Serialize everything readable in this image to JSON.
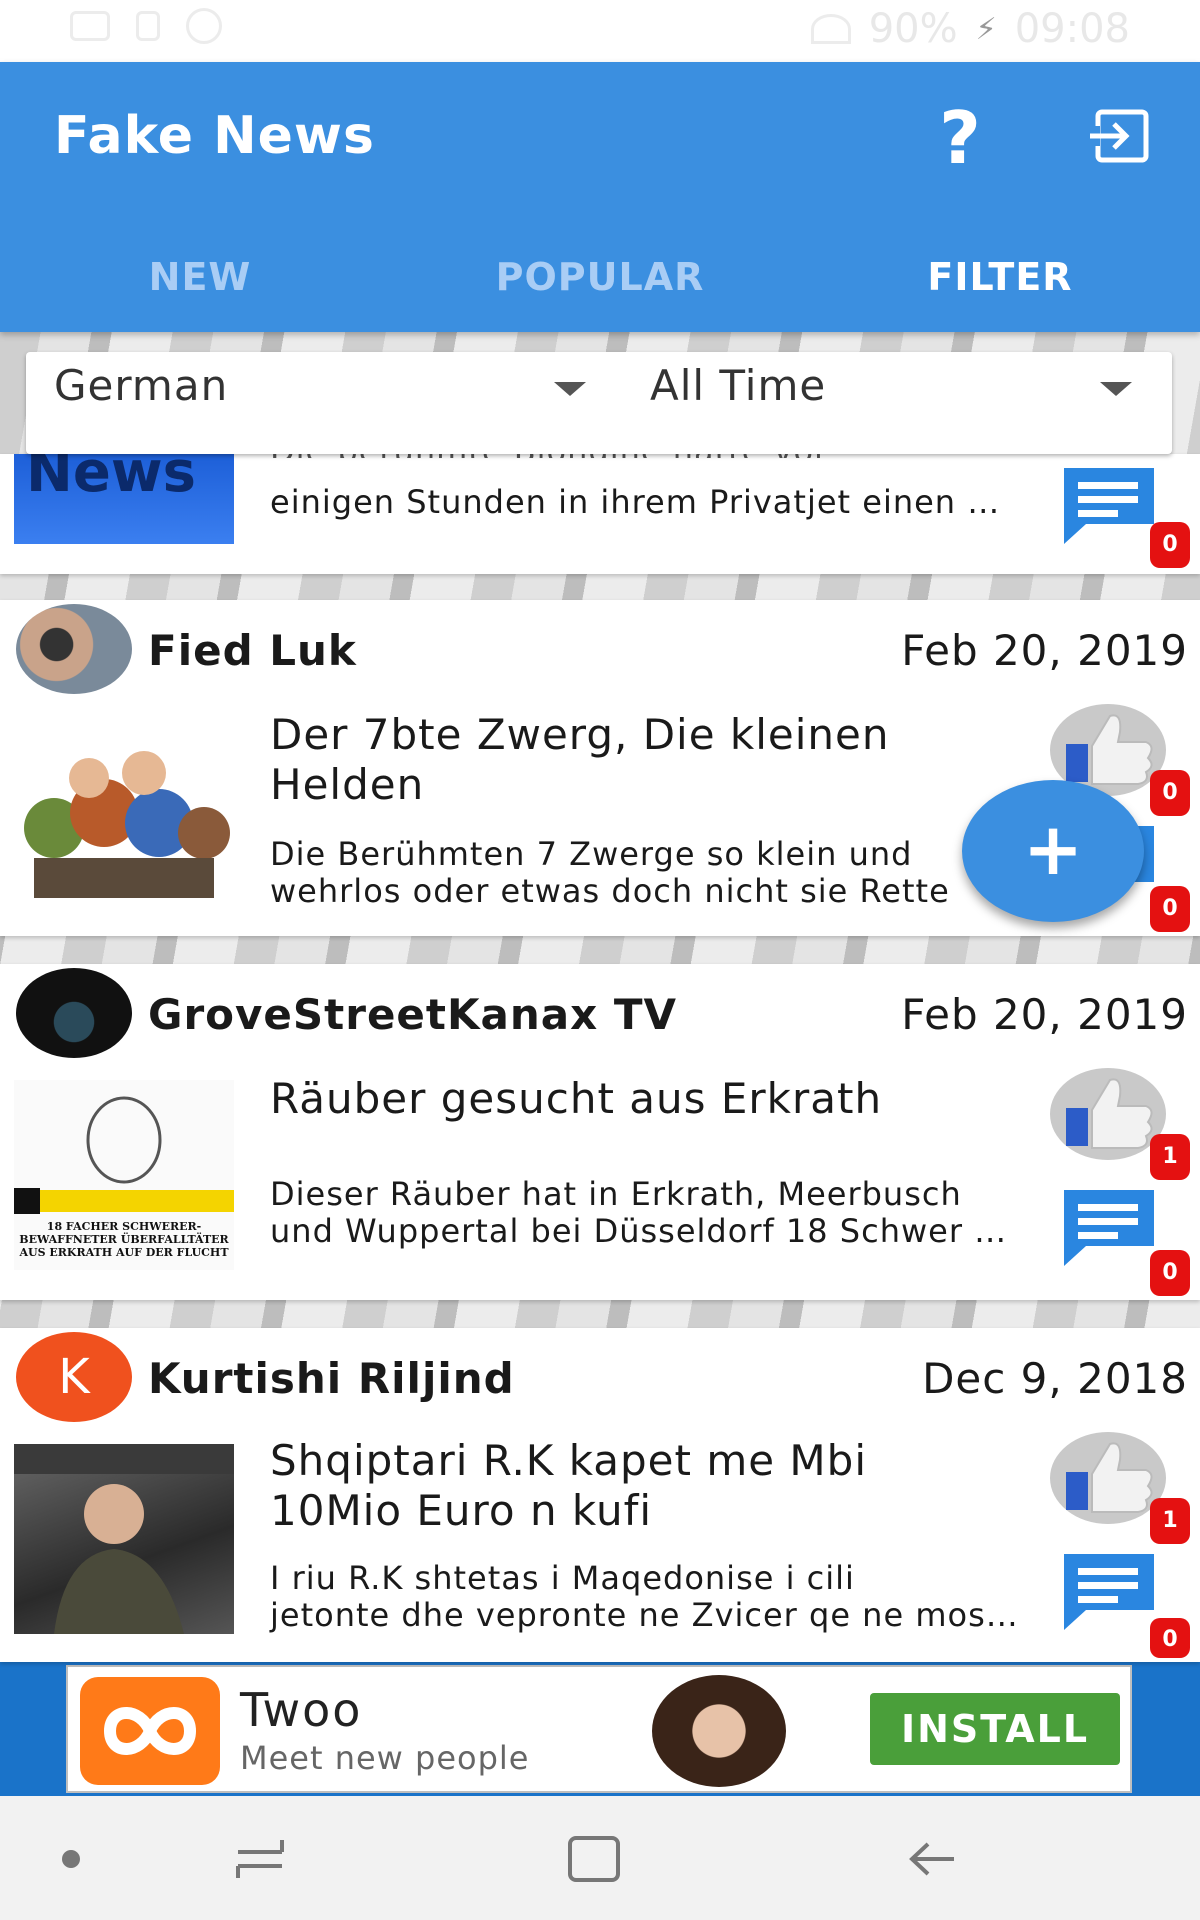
{
  "status_bar": {
    "battery": "90%",
    "time": "09:08"
  },
  "app_bar": {
    "title": "Fake News",
    "help_label": "?",
    "tabs": [
      {
        "label": "NEW"
      },
      {
        "label": "POPULAR"
      },
      {
        "label": "FILTER"
      }
    ],
    "active_tab": "FILTER",
    "accent_color": "#3b8fe0"
  },
  "filters": {
    "language": "German",
    "time_range": "All Time"
  },
  "partial_card": {
    "thumb_text": "News",
    "excerpt_hidden_line": "Die berühmte Blondine hatte vor",
    "excerpt": "einigen Stunden in ihrem Privatjet einen …",
    "comment_count": "0"
  },
  "cards": [
    {
      "author": "Fied Luk",
      "date": "Feb 20, 2019",
      "headline_line1": "Der 7bte Zwerg, Die kleinen",
      "headline_line2": "Helden",
      "excerpt_line1": "Die Berühmten 7 Zwerge so klein und",
      "excerpt_line2": "wehrlos oder etwas doch nicht sie Rette",
      "like_count": "0",
      "comment_count": "0"
    },
    {
      "author": "GroveStreetKanax TV",
      "date": "Feb 20, 2019",
      "headline_line1": "Räuber gesucht aus Erkrath",
      "headline_line2": "",
      "excerpt_line1": "Dieser Räuber hat in Erkrath, Meerbusch",
      "excerpt_line2": "und Wuppertal bei Düsseldorf 18 Schwer …",
      "thumb_caption": "18 FACHER SCHWERER-BEWAFFNETER ÜBERFALLTÄTER AUS ERKRATH AUF DER FLUCHT",
      "like_count": "1",
      "comment_count": "0"
    },
    {
      "author": "Kurtishi Riljind",
      "avatar_letter": "K",
      "date": "Dec 9, 2018",
      "headline_line1": "Shqiptari R.K kapet me Mbi",
      "headline_line2": "10Mio Euro n kufi",
      "excerpt_line1": "I riu R.K shtetas i Maqedonise i cili",
      "excerpt_line2": "jetonte dhe vepronte ne Zvicer qe ne mos…",
      "like_count": "1",
      "comment_count": "0"
    }
  ],
  "fab": {
    "label": "+"
  },
  "ad": {
    "title": "Twoo",
    "subtitle": "Meet new people",
    "cta": "INSTALL",
    "cta_color": "#4a9f3a",
    "logo_color": "#ff7a18"
  }
}
